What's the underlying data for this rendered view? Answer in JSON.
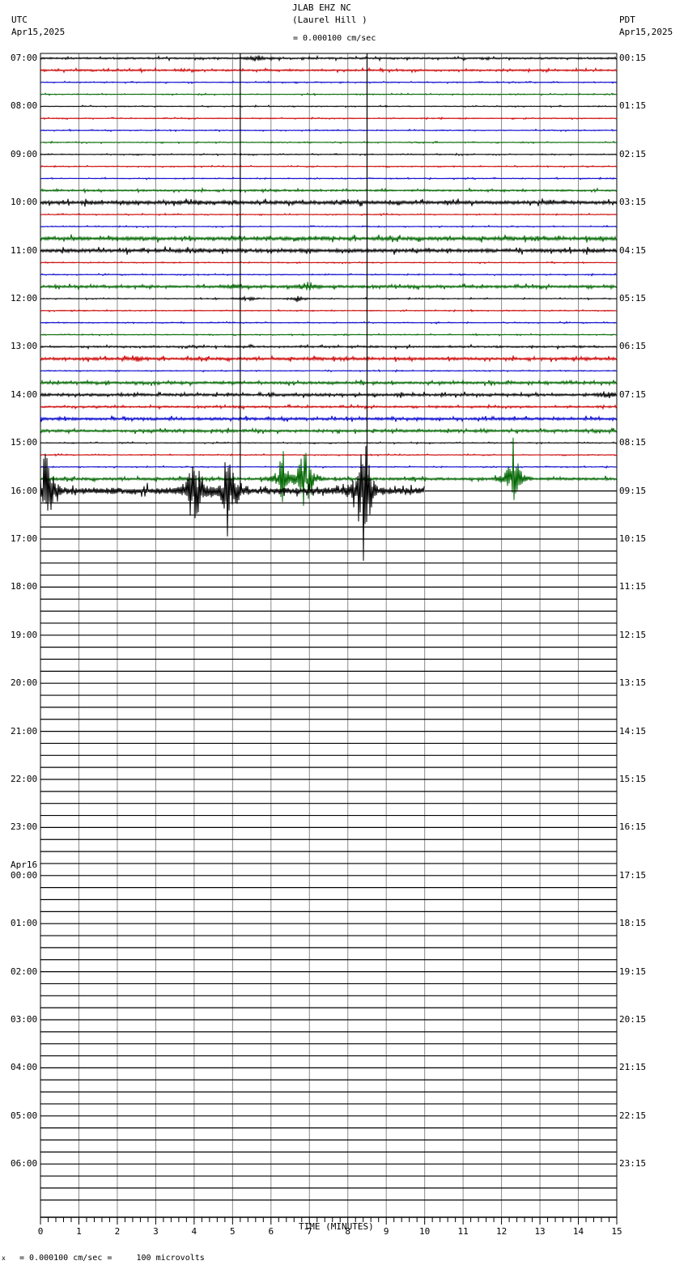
{
  "header": {
    "station": "JLAB EHZ NC",
    "location": "(Laurel Hill )",
    "left_tz": "UTC",
    "left_date": "Apr15,2025",
    "right_tz": "PDT",
    "right_date": "Apr15,2025",
    "scale": "= 0.000100 cm/sec"
  },
  "footer": {
    "scale_note": "= 0.000100 cm/sec =     100 microvolts",
    "mark": "x"
  },
  "chart_data": {
    "type": "line",
    "title": "JLAB EHZ NC (Laurel Hill )",
    "xlabel": "TIME (MINUTES)",
    "xlim": [
      0,
      15
    ],
    "x_ticks": [
      "0",
      "1",
      "2",
      "3",
      "4",
      "5",
      "6",
      "7",
      "8",
      "9",
      "10",
      "11",
      "12",
      "13",
      "14",
      "15"
    ],
    "minutes_per_row": 15,
    "rows": 96,
    "data_rows": 37,
    "last_row_end_minute": 10,
    "trace_colors": [
      "#000000",
      "#cc0000",
      "#0000cc",
      "#006600"
    ],
    "left_labels": [
      "07:00",
      "08:00",
      "09:00",
      "10:00",
      "11:00",
      "12:00",
      "13:00",
      "14:00",
      "15:00",
      "16:00",
      "17:00",
      "18:00",
      "19:00",
      "20:00",
      "21:00",
      "22:00",
      "23:00",
      "00:00",
      "01:00",
      "02:00",
      "03:00",
      "04:00",
      "05:00",
      "06:00"
    ],
    "left_date_change": "Apr16",
    "right_labels": [
      "00:15",
      "01:15",
      "02:15",
      "03:15",
      "04:15",
      "05:15",
      "06:15",
      "07:15",
      "08:15",
      "09:15",
      "10:15",
      "11:15",
      "12:15",
      "13:15",
      "14:15",
      "15:15",
      "16:15",
      "17:15",
      "18:15",
      "19:15",
      "20:15",
      "21:15",
      "22:15",
      "23:15"
    ],
    "events": [
      {
        "row": 0,
        "minute": 5.6,
        "amplitude": 6
      },
      {
        "row": 12,
        "minute": 4.0,
        "amplitude": 4
      },
      {
        "row": 19,
        "minute": 5.0,
        "amplitude": 6
      },
      {
        "row": 19,
        "minute": 7.0,
        "amplitude": 8
      },
      {
        "row": 20,
        "minute": 5.4,
        "amplitude": 5
      },
      {
        "row": 20,
        "minute": 6.7,
        "amplitude": 5
      },
      {
        "row": 25,
        "minute": 2.5,
        "amplitude": 4
      },
      {
        "row": 28,
        "minute": 14.7,
        "amplitude": 8
      },
      {
        "row": 35,
        "minute": 12.3,
        "amplitude": 60
      },
      {
        "row": 35,
        "minute": 6.3,
        "amplitude": 40
      },
      {
        "row": 35,
        "minute": 6.9,
        "amplitude": 60
      },
      {
        "row": 36,
        "minute": 0.15,
        "amplitude": 65
      },
      {
        "row": 36,
        "minute": 4.0,
        "amplitude": 70
      },
      {
        "row": 36,
        "minute": 4.9,
        "amplitude": 75
      },
      {
        "row": 36,
        "minute": 8.4,
        "amplitude": 110
      }
    ],
    "noise_levels": [
      2,
      2,
      1,
      1,
      1,
      1,
      1,
      1,
      1,
      1,
      1,
      2,
      4,
      1,
      1,
      4,
      4,
      1,
      1,
      3,
      1,
      1,
      1,
      1,
      2,
      3,
      1,
      3,
      3,
      2,
      3,
      3,
      1,
      1,
      1,
      3,
      8
    ]
  }
}
